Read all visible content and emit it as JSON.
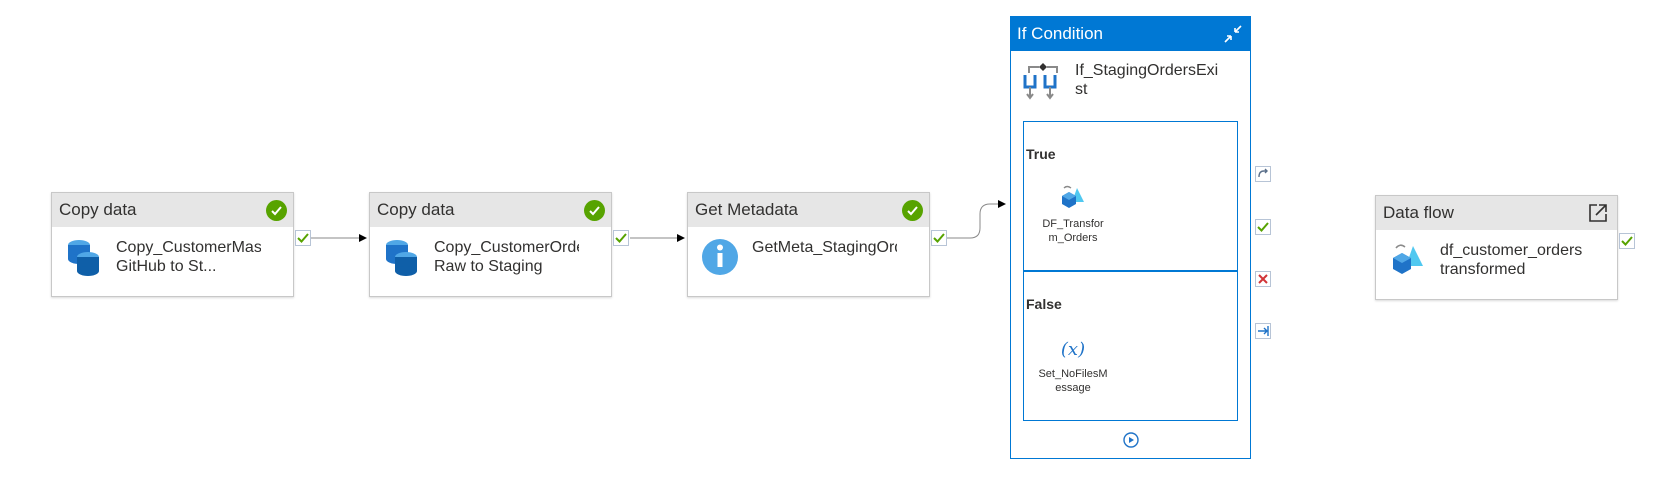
{
  "activities": [
    {
      "type_label": "Copy data",
      "name": "Copy_CustomerMaster GitHub to St...",
      "status": "succeeded",
      "icon": "copy-data-icon"
    },
    {
      "type_label": "Copy data",
      "name": "Copy_CustomerOrders Raw to Staging",
      "status": "succeeded",
      "icon": "copy-data-icon"
    },
    {
      "type_label": "Get Metadata",
      "name": "GetMeta_StagingOrders",
      "status": "succeeded",
      "icon": "info-icon"
    },
    {
      "type_label": "Data flow",
      "name": "df_customer_orders transformed",
      "status": "none",
      "icon": "dataflow-icon"
    }
  ],
  "if_condition": {
    "type_label": "If Condition",
    "name": "If_StagingOrdersExist",
    "true_branch": {
      "label": "True",
      "activity_name": "DF_Transform_Orders"
    },
    "false_branch": {
      "label": "False",
      "activity_name": "Set_NoFilesMessage"
    }
  },
  "colors": {
    "accent": "#0078d4",
    "success": "#57a300",
    "fail": "#d13438",
    "header_bg": "#e6e6e6"
  }
}
